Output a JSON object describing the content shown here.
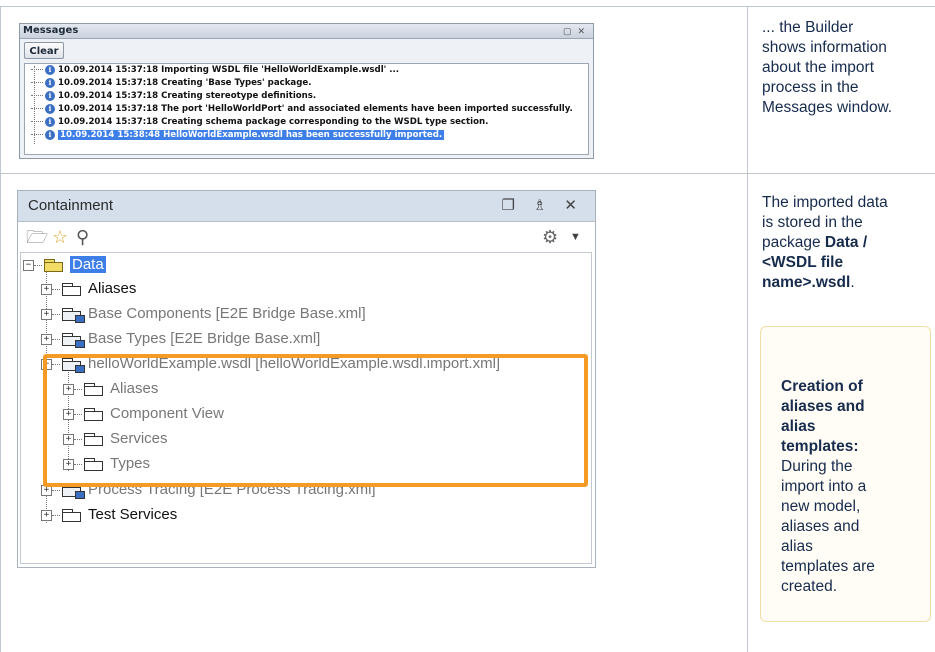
{
  "messages_panel": {
    "title": "Messages",
    "clear_label": "Clear",
    "rows": [
      "10.09.2014 15:37:18 Importing WSDL file 'HelloWorldExample.wsdl' ...",
      "10.09.2014 15:37:18 Creating 'Base Types' package.",
      "10.09.2014 15:37:18 Creating stereotype definitions.",
      "10.09.2014 15:37:18 The port 'HelloWorldPort' and associated elements have been imported successfully.",
      "10.09.2014 15:37:18 Creating schema package corresponding to the WSDL type section.",
      "10.09.2014 15:38:48 HelloWorldExample.wsdl has been successfully imported."
    ]
  },
  "row1_description": {
    "line1": "... the Builder",
    "line2": "shows information",
    "line3": "about the import",
    "line4": "process in the",
    "line5": "Messages window."
  },
  "containment_panel": {
    "title": "Containment",
    "tree": {
      "root": "Data",
      "items": [
        "Aliases",
        "Base Components [E2E Bridge Base.xml]",
        "Base Types [E2E Bridge Base.xml]",
        "helloWorldExample.wsdl [helloWorldExample.wsdl.import.xml]",
        "Aliases",
        "Component View",
        "Services",
        "Types",
        "Process Tracing [E2E Process Tracing.xml]",
        "Test Services"
      ]
    }
  },
  "row2_description": {
    "line1": "The imported data",
    "line2": "is stored in the",
    "line3_plain": "package ",
    "line3_bold": "Data /",
    "line4_bold": "<WSDL file",
    "line5_bold": "name>.wsdl",
    "line5_plain": "."
  },
  "note": {
    "heading1": "Creation of",
    "heading2": "aliases and",
    "heading3": "alias",
    "heading4": "templates:",
    "body1": "During the",
    "body2": "import into a",
    "body3": "new model,",
    "body4": "aliases and",
    "body5": "alias",
    "body6": "templates are",
    "body7": "created."
  },
  "colors": {
    "highlight": "#f59b24",
    "selection": "#3d7ee8"
  }
}
